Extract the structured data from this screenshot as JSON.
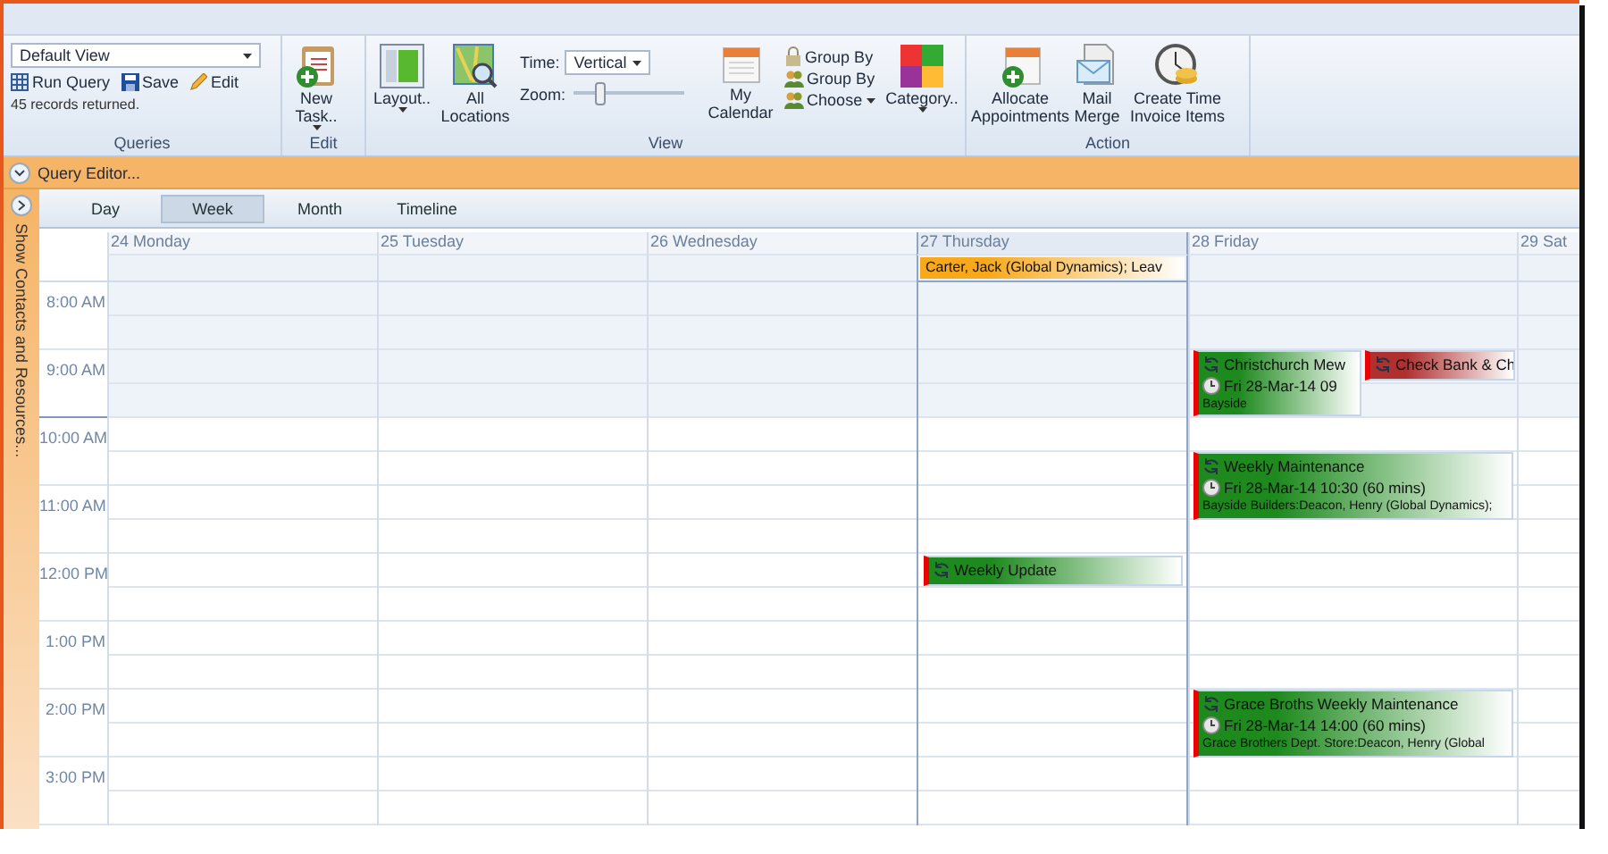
{
  "queries": {
    "view_select": "Default View",
    "actions": [
      {
        "label": "Run Query",
        "kind": "run"
      },
      {
        "label": "Save",
        "kind": "save"
      },
      {
        "label": "Edit",
        "kind": "edit"
      }
    ],
    "record_count": "45 records returned.",
    "group_label": "Queries"
  },
  "edit_group": {
    "new_task": "New Task..",
    "group_label": "Edit"
  },
  "view_group": {
    "layout": "Layout..",
    "all_locations": "All Locations",
    "time_label": "Time:",
    "time_value": "Vertical",
    "zoom_label": "Zoom:",
    "zoom": {
      "level": 0.25
    },
    "my_calendar": "My Calendar",
    "group_options": [
      {
        "label": "Group By",
        "kind": "lock"
      },
      {
        "label": "Group By",
        "kind": "people"
      },
      {
        "label": "Choose",
        "kind": "choose"
      }
    ],
    "category": "Category..",
    "group_label": "View"
  },
  "action_group": {
    "buttons": [
      {
        "label": "Allocate Appointments",
        "kind": "allocate"
      },
      {
        "label": "Mail Merge",
        "kind": "mail"
      },
      {
        "label": "Create Time Invoice Items",
        "kind": "invoice"
      }
    ],
    "group_label": "Action"
  },
  "query_editor": {
    "label": "Query Editor...",
    "expanded": false
  },
  "side_panel": {
    "label": "Show Contacts and Resources..."
  },
  "view_tabs": [
    {
      "label": "Day",
      "selected": false
    },
    {
      "label": "Week",
      "selected": true
    },
    {
      "label": "Month",
      "selected": false
    },
    {
      "label": "Timeline",
      "selected": false
    }
  ],
  "time_labels": [
    "8:00 AM",
    "9:00 AM",
    "10:00 AM",
    "11:00 AM",
    "12:00 PM",
    "1:00 PM",
    "2:00 PM",
    "3:00 PM"
  ],
  "days": [
    {
      "label": "24 Monday",
      "selected": false
    },
    {
      "label": "25 Tuesday",
      "selected": false
    },
    {
      "label": "26 Wednesday",
      "selected": false
    },
    {
      "label": "27 Thursday",
      "selected": true,
      "all_day": [
        {
          "title": "Carter, Jack (Global Dynamics); Leav",
          "color": "#f7a81b"
        }
      ],
      "events": [
        {
          "title": "Weekly Update",
          "color": "#1e8a1e"
        }
      ]
    },
    {
      "label": "28 Friday",
      "selected": false,
      "events": [
        {
          "title": "Christchurch Mew",
          "time": "Fri 28-Mar-14 09",
          "detail": "Bayside",
          "color": "#1e8a1e"
        },
        {
          "title": "Check Bank & Ch",
          "color": "#b03030"
        },
        {
          "title": "Weekly Maintenance",
          "time": "Fri 28-Mar-14 10:30 (60 mins)",
          "detail": "Bayside Builders:Deacon, Henry (Global Dynamics);",
          "color": "#1e8a1e"
        },
        {
          "title": "Grace Broths Weekly Maintenance",
          "time": "Fri 28-Mar-14 14:00 (60 mins)",
          "detail": "Grace Brothers Dept. Store:Deacon, Henry (Global",
          "color": "#1e8a1e"
        }
      ]
    },
    {
      "label": "29 Sat",
      "selected": false
    }
  ]
}
